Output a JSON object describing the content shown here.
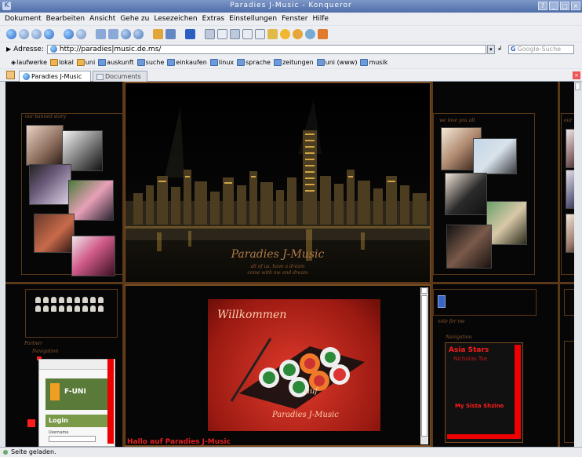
{
  "window": {
    "title": "Paradies J-Music - Konqueror"
  },
  "menu": [
    "Dokument",
    "Bearbeiten",
    "Ansicht",
    "Gehe zu",
    "Lesezeichen",
    "Extras",
    "Einstellungen",
    "Fenster",
    "Hilfe"
  ],
  "toolbar_icons": [
    "zoom-in-icon",
    "zoom-out-icon",
    "back-icon",
    "forward-icon",
    "up-icon",
    "home-icon",
    "reload-icon",
    "stop-icon",
    "print-icon",
    "cut-icon",
    "copy-icon",
    "paste-icon",
    "find-icon",
    "bookmark-icon",
    "security-icon",
    "window-icon",
    "split-icon",
    "sidebar-icon",
    "fullscreen-icon",
    "star-icon",
    "star-icon",
    "gear-icon",
    "home-icon"
  ],
  "address": {
    "label": "Adresse:",
    "url": "http://paradies|music.de.ms/",
    "search_placeholder": "Google-Suche"
  },
  "bookmarks": [
    "laufwerke",
    "lokal",
    "uni",
    "auskunft",
    "suche",
    "einkaufen",
    "linux",
    "sprache",
    "zeitungen",
    "uni (www)",
    "musik"
  ],
  "tabs": [
    {
      "label": "Paradies J-Music",
      "active": true
    },
    {
      "label": "Documents",
      "active": false
    }
  ],
  "page": {
    "left_heading": "our banned story",
    "right_heading": "we love you all",
    "right_heading2": "our",
    "banner_title": "Paradies J-Music",
    "banner_sub1": "all of us, have a dream",
    "banner_sub2": "come with me and dream",
    "partner_heading": "Partner",
    "navi_heading": "Navigation",
    "vote_heading": "vote for me",
    "navi_heading_right": "Navigation",
    "welcome_line1": "Willkommen",
    "welcome_line2": "auf",
    "welcome_line3": "Paradies J-Music",
    "bottom_text": "Hallo auf Paradies J-Music",
    "funi_label": "F-UNI",
    "login_label": "Login",
    "login_field": "Username",
    "radio_item1": "Asia Stars",
    "radio_item2": "Nicholas Tse",
    "radio_item3": "My Sista Shzine"
  },
  "status": {
    "text": "Seite geladen."
  }
}
